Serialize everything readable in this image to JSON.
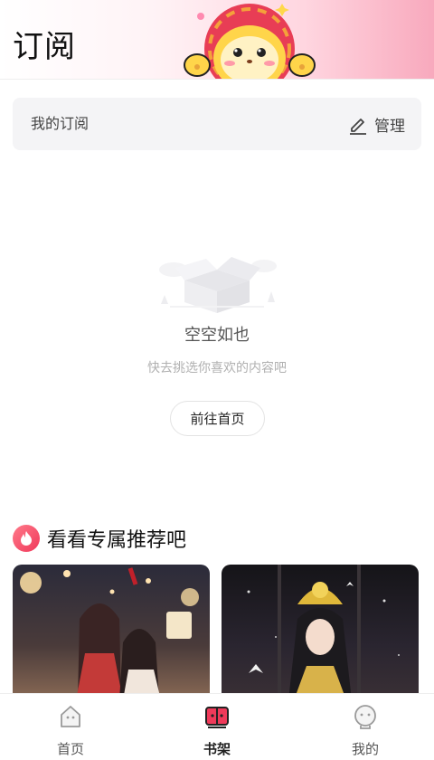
{
  "header": {
    "title": "订阅"
  },
  "subscription": {
    "label": "我的订阅",
    "manage_label": "管理"
  },
  "empty_state": {
    "title": "空空如也",
    "subtitle": "快去挑选你喜欢的内容吧",
    "button_label": "前往首页"
  },
  "recommend": {
    "title": "看看专属推荐吧"
  },
  "bottom_nav": [
    {
      "label": "首页",
      "icon": "home-icon",
      "active": false
    },
    {
      "label": "书架",
      "icon": "bookshelf-icon",
      "active": true
    },
    {
      "label": "我的",
      "icon": "profile-icon",
      "active": false
    }
  ],
  "colors": {
    "accent": "#f0385a",
    "header_gradient_end": "#f8a9bd",
    "background": "#ffffff"
  }
}
